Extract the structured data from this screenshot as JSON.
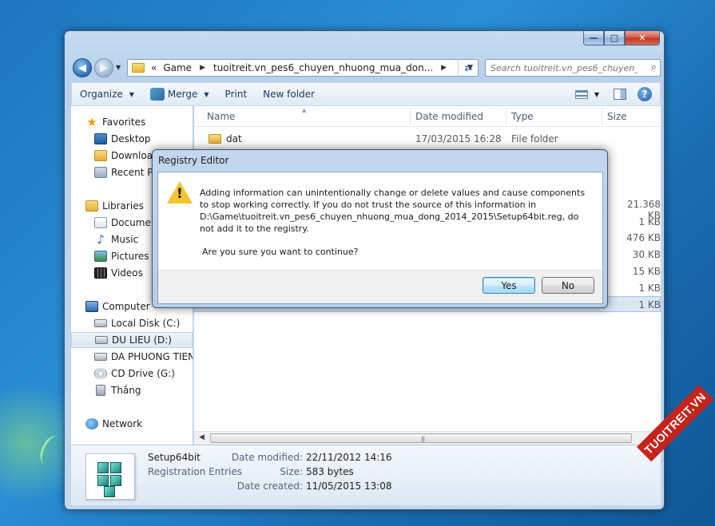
{
  "window": {
    "caption": {
      "minimize": "—",
      "maximize": "□",
      "close": "✕"
    }
  },
  "address_bar": {
    "overflow": "«",
    "segments": [
      "Game",
      "tuoitreit.vn_pes6_chuyen_nhuong_mua_don..."
    ],
    "search_placeholder": "Search tuoitreit.vn_pes6_chuyen_n..."
  },
  "toolbar": {
    "organize": "Organize",
    "merge": "Merge",
    "print": "Print",
    "new_folder": "New folder"
  },
  "nav_pane": {
    "favorites": "Favorites",
    "desktop": "Desktop",
    "downloads": "Download",
    "recent": "Recent Pl",
    "libraries": "Libraries",
    "documents": "Documen",
    "music": "Music",
    "pictures": "Pictures",
    "videos": "Videos",
    "computer": "Computer",
    "local_disk": "Local Disk (C:)",
    "du_lieu": "DU LIEU (D:)",
    "da_phuong_tien": "DA PHUONG TIEN",
    "cd_drive": "CD Drive (G:)",
    "thang": "Thắng",
    "network": "Network"
  },
  "file_list": {
    "columns": {
      "name": "Name",
      "date": "Date modified",
      "type": "Type",
      "size": "Size"
    },
    "rows": [
      {
        "name": "dat",
        "date": "17/03/2015 16:28",
        "type": "File folder",
        "size": ""
      }
    ],
    "sizes": [
      "21.368 KB",
      "1 KB",
      "476 KB",
      "30 KB",
      "15 KB",
      "1 KB",
      "1 KB"
    ]
  },
  "details": {
    "name": "Setup64bit",
    "type": "Registration Entries",
    "date_modified_label": "Date modified:",
    "date_modified": "22/11/2012 14:16",
    "size_label": "Size:",
    "size": "583 bytes",
    "date_created_label": "Date created:",
    "date_created": "11/05/2015 13:08"
  },
  "dialog": {
    "title": "Registry Editor",
    "message": "Adding information can unintentionally change or delete values and cause components to stop working correctly. If you do not trust the source of this information in D:\\Game\\tuoitreit.vn_pes6_chuyen_nhuong_mua_dong_2014_2015\\Setup64bit.reg, do not add it to the registry.",
    "question": "Are you sure you want to continue?",
    "yes": "Yes",
    "no": "No"
  },
  "watermark": "TUOITREIT.VN"
}
